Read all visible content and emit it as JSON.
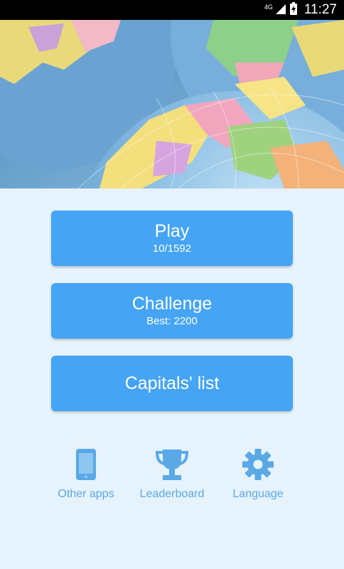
{
  "status_bar": {
    "network": "4G",
    "time": "11:27",
    "icons": [
      "signal-icon",
      "battery-charging-icon"
    ]
  },
  "hero": {
    "image": "globe-map-photo"
  },
  "menu": {
    "play": {
      "title": "Play",
      "subtitle": "10/1592"
    },
    "challenge": {
      "title": "Challenge",
      "subtitle": "Best: 2200"
    },
    "capitals": {
      "title": "Capitals' list"
    }
  },
  "bottom_nav": {
    "other_apps": {
      "label": "Other apps",
      "icon": "phone-icon"
    },
    "leaderboard": {
      "label": "Leaderboard",
      "icon": "trophy-icon"
    },
    "language": {
      "label": "Language",
      "icon": "gear-icon"
    }
  },
  "colors": {
    "background": "#e6f2fc",
    "button": "#45a4f4",
    "accent_text": "#5aa9e6"
  }
}
